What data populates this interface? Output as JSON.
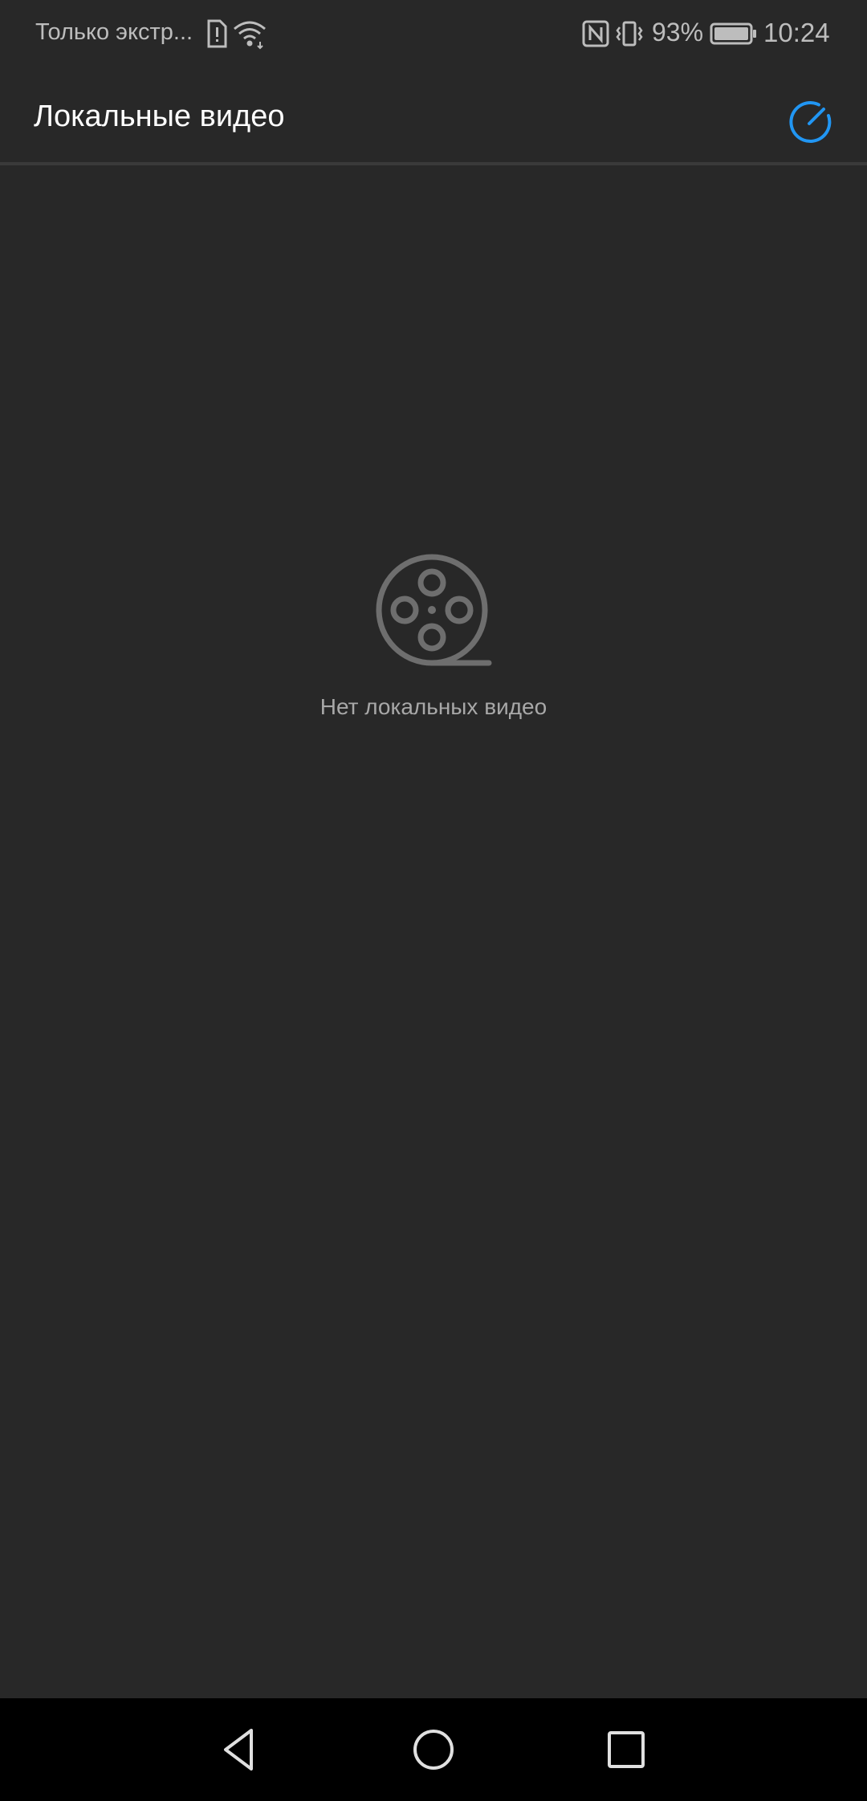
{
  "status_bar": {
    "carrier": "Только экстр...",
    "battery_percent": "93%",
    "time": "10:24",
    "icons": [
      "sim-alert-icon",
      "wifi-icon",
      "nfc-icon",
      "vibrate-icon",
      "battery-icon"
    ]
  },
  "app_bar": {
    "title": "Локальные видео",
    "action_icon": "refresh-icon"
  },
  "empty_state": {
    "icon": "film-reel-icon",
    "message": "Нет локальных видео"
  },
  "nav_bar": {
    "buttons": [
      "back-icon",
      "home-icon",
      "recents-icon"
    ]
  },
  "colors": {
    "background": "#282828",
    "accent": "#2196F3",
    "muted_icon": "#6e6e6e",
    "nav_background": "#000000"
  }
}
